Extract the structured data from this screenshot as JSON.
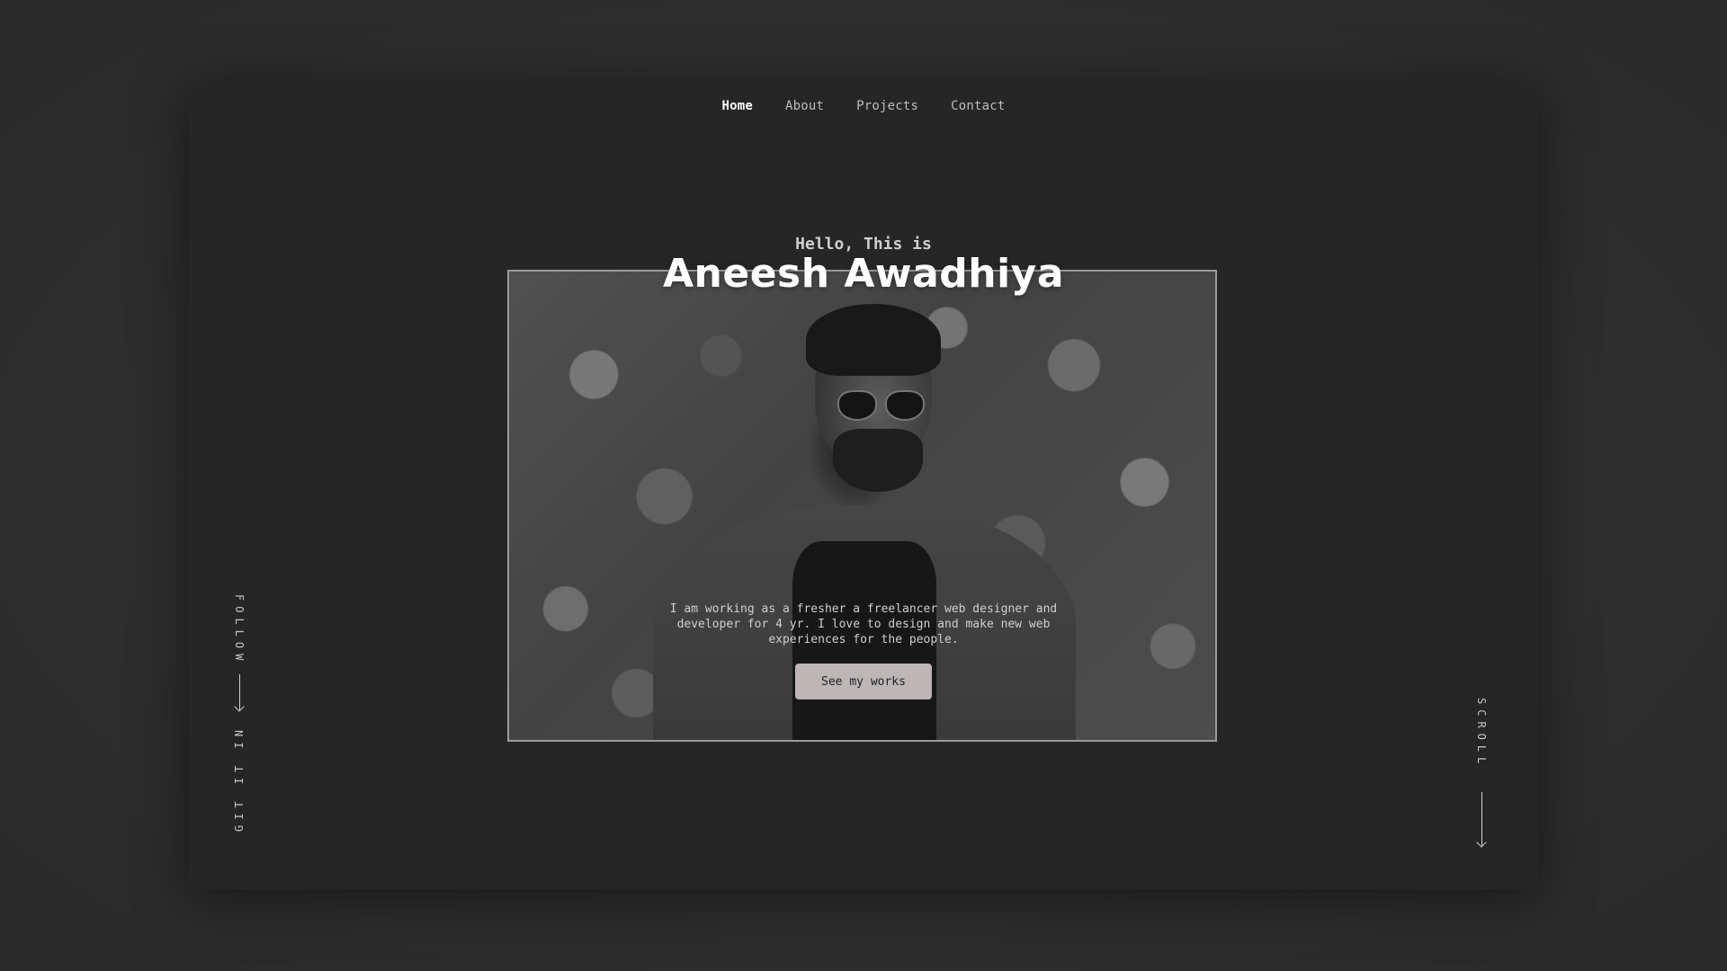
{
  "nav": {
    "items": [
      {
        "label": "Home",
        "active": true
      },
      {
        "label": "About",
        "active": false
      },
      {
        "label": "Projects",
        "active": false
      },
      {
        "label": "Contact",
        "active": false
      }
    ]
  },
  "hero": {
    "greeting": "Hello, This is",
    "name": "Aneesh Awadhiya",
    "description": "I am working as a fresher a freelancer web designer and developer for 4 yr. I love to design and make new web experiences for the people.",
    "cta_label": "See my works"
  },
  "side": {
    "follow_label": "FOLLOW",
    "social_label": "GIT IT IN",
    "scroll_label": "SCROLL"
  },
  "colors": {
    "background": "#2f2f2f",
    "panel": "#262626",
    "cta_bg": "#bcb6b6",
    "text_primary": "#ffffff"
  }
}
